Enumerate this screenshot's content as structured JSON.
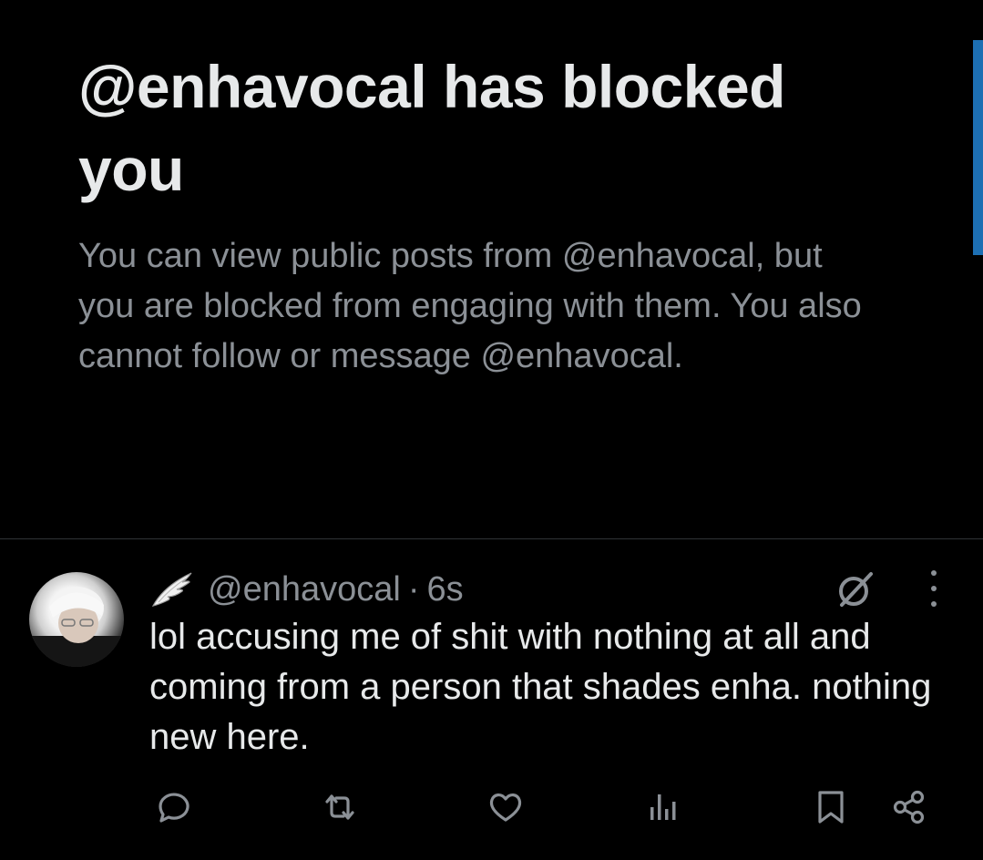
{
  "blocked": {
    "title": "@enhavocal has blocked you",
    "description": "You can view public posts from @enhavocal, but you are blocked from engaging with them. You also cannot follow or message @enhavocal."
  },
  "post": {
    "handle": "@enhavocal",
    "separator": "·",
    "time": "6s",
    "text": "lol accusing me of shit with nothing at all and coming from a person that shades enha. nothing new here."
  },
  "icons": {
    "header": [
      "wing-icon",
      "grok-icon",
      "more-icon"
    ],
    "actions": [
      "reply-icon",
      "repost-icon",
      "like-icon",
      "views-icon",
      "bookmark-icon",
      "share-icon"
    ]
  },
  "colors": {
    "background": "#000000",
    "text": "#e7e9ea",
    "muted": "#8b9096",
    "scrollbar": "#1d6fb3"
  }
}
